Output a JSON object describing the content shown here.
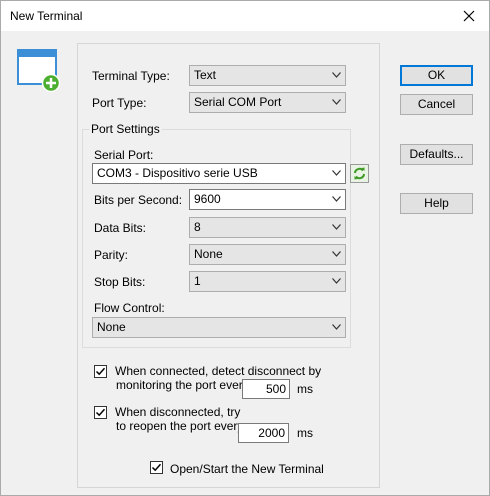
{
  "window": {
    "title": "New Terminal",
    "close_glyph": "✕"
  },
  "terminal_type": {
    "label": "Terminal Type:",
    "value": "Text"
  },
  "port_type": {
    "label": "Port Type:",
    "value": "Serial COM Port"
  },
  "port_settings": {
    "group_title": "Port Settings",
    "serial_port": {
      "label": "Serial Port:",
      "value": "COM3 - Dispositivo serie USB"
    },
    "bits_per_second": {
      "label": "Bits per Second:",
      "value": "9600"
    },
    "data_bits": {
      "label": "Data Bits:",
      "value": "8"
    },
    "parity": {
      "label": "Parity:",
      "value": "None"
    },
    "stop_bits": {
      "label": "Stop Bits:",
      "value": "1"
    },
    "flow_control": {
      "label": "Flow Control:",
      "value": "None"
    }
  },
  "disconnect_detect": {
    "checked": true,
    "line1": "When connected, detect disconnect by",
    "line2": "monitoring the port every",
    "value": "500",
    "unit": "ms"
  },
  "reopen": {
    "checked": true,
    "line1": "When disconnected, try",
    "line2": "to reopen the port every",
    "value": "2000",
    "unit": "ms"
  },
  "open_start": {
    "checked": true,
    "label": "Open/Start the New Terminal"
  },
  "buttons": {
    "ok": "OK",
    "cancel": "Cancel",
    "defaults": "Defaults...",
    "help": "Help"
  },
  "icons": {
    "app": "new-terminal-window-icon",
    "refresh": "refresh-icon",
    "chevron": "chevron-down-icon",
    "check": "checkmark-icon"
  },
  "colors": {
    "accent": "#0078d7",
    "green": "#4caf30"
  }
}
